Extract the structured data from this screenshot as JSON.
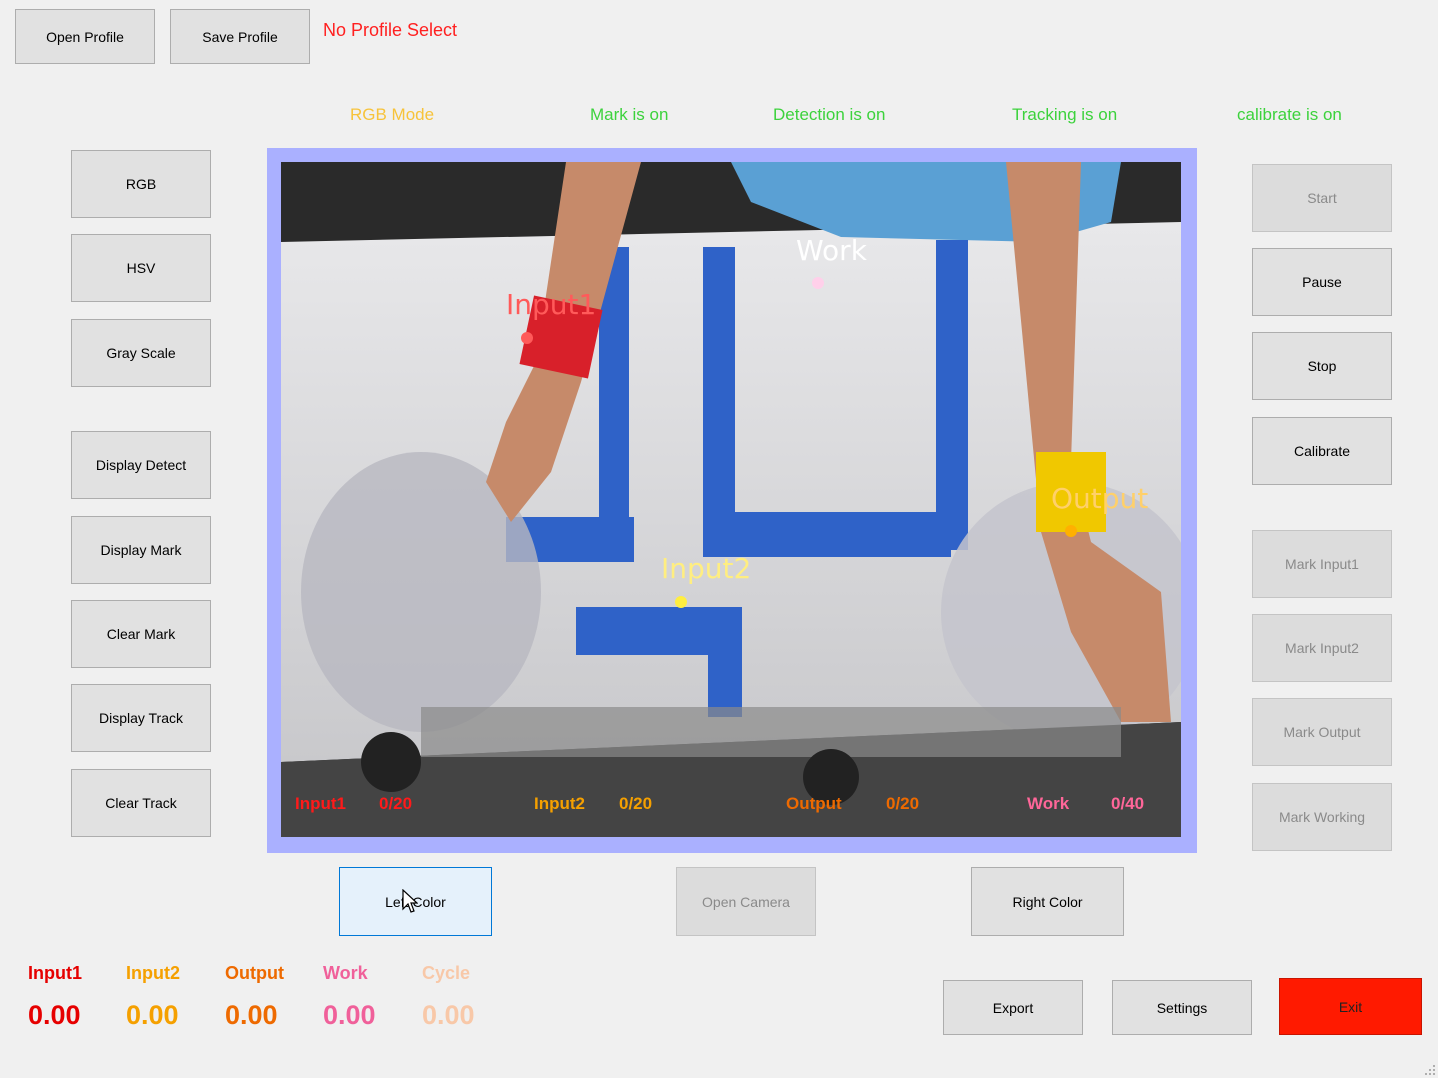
{
  "toolbar": {
    "open_profile": "Open Profile",
    "save_profile": "Save Profile",
    "profile_status": "No Profile Select"
  },
  "status_bar": {
    "mode": "RGB Mode",
    "mark": "Mark is on",
    "detection": "Detection is on",
    "tracking": "Tracking is on",
    "calibrate": "calibrate is on"
  },
  "left_buttons": {
    "rgb": "RGB",
    "hsv": "HSV",
    "gray": "Gray Scale",
    "display_detect": "Display Detect",
    "display_mark": "Display Mark",
    "clear_mark": "Clear Mark",
    "display_track": "Display Track",
    "clear_track": "Clear Track"
  },
  "right_buttons": {
    "start": "Start",
    "pause": "Pause",
    "stop": "Stop",
    "calibrate": "Calibrate",
    "mark_input1": "Mark Input1",
    "mark_input2": "Mark Input2",
    "mark_output": "Mark Output",
    "mark_working": "Mark Working"
  },
  "video_overlay": {
    "input1": "Input1",
    "input2": "Input2",
    "work": "Work",
    "output": "Output"
  },
  "video_counters": [
    {
      "name": "Input1",
      "count": "0/20"
    },
    {
      "name": "Input2",
      "count": "0/20"
    },
    {
      "name": "Output",
      "count": "0/20"
    },
    {
      "name": "Work",
      "count": "0/40"
    }
  ],
  "bottom_buttons": {
    "left_color": "Left Color",
    "open_camera": "Open Camera",
    "right_color": "Right Color",
    "export": "Export",
    "settings": "Settings",
    "exit": "Exit"
  },
  "stats": {
    "input1": {
      "label": "Input1",
      "value": "0.00"
    },
    "input2": {
      "label": "Input2",
      "value": "0.00"
    },
    "output": {
      "label": "Output",
      "value": "0.00"
    },
    "work": {
      "label": "Work",
      "value": "0.00"
    },
    "cycle": {
      "label": "Cycle",
      "value": "0.00"
    }
  },
  "colors": {
    "red": "#e60000",
    "orange": "#f5a000",
    "dark_orange": "#ee6a00",
    "pink": "#f0609a",
    "light_orange": "#f8c8a8",
    "green": "#3cd23c",
    "yellow": "#f5d22a",
    "exit_red": "#ff1a00",
    "frame_blue": "#aab0ff"
  }
}
